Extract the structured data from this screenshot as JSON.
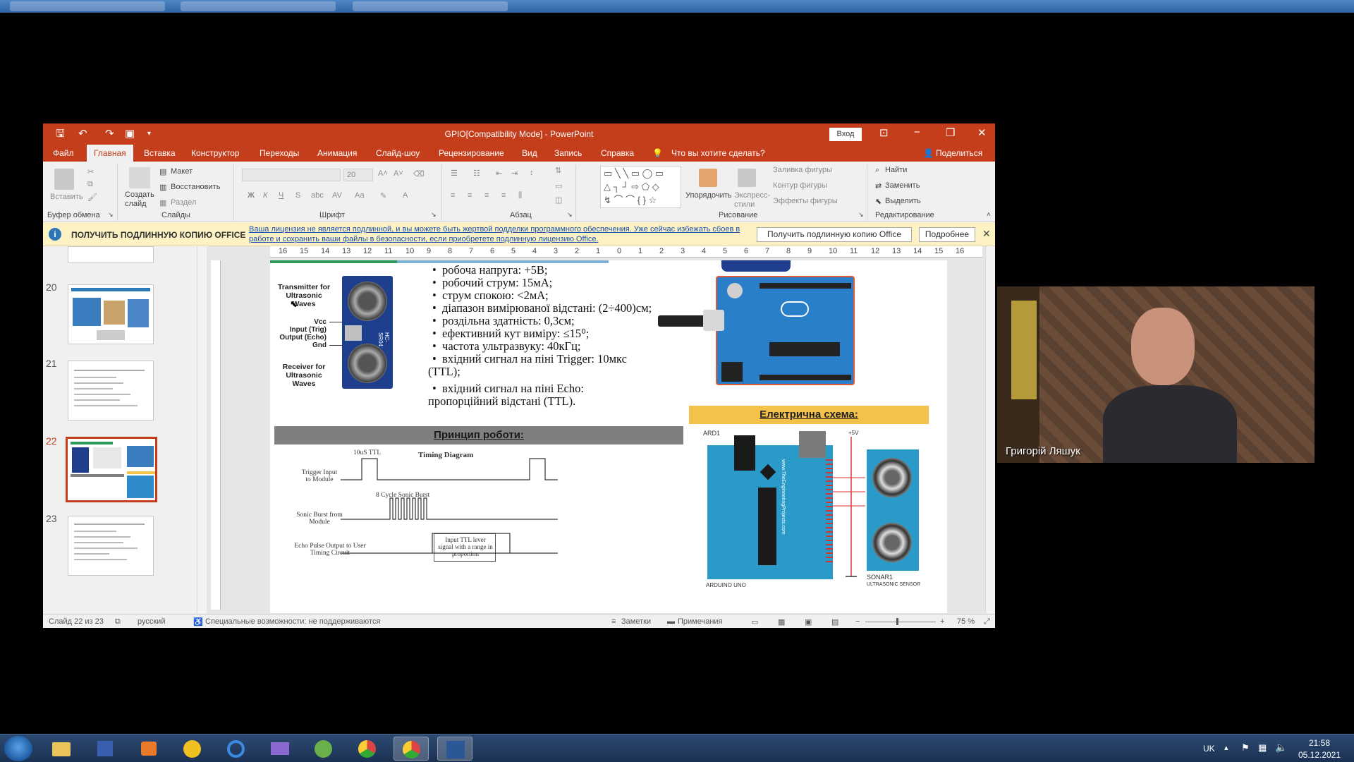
{
  "window": {
    "title": "GPIO[Compatibility Mode] - PowerPoint",
    "signin": "Вход"
  },
  "ribbon_tabs": [
    "Файл",
    "Главная",
    "Вставка",
    "Конструктор",
    "Переходы",
    "Анимация",
    "Слайд-шоу",
    "Рецензирование",
    "Вид",
    "Запись",
    "Справка"
  ],
  "tell_me": "Что вы хотите сделать?",
  "share": "Поделиться",
  "ribbon": {
    "clipboard": {
      "paste": "Вставить",
      "group": "Буфер обмена"
    },
    "slides": {
      "new_slide": "Создать слайд",
      "layout": "Макет",
      "reset": "Восстановить",
      "section": "Раздел",
      "group": "Слайды"
    },
    "font": {
      "size": "20",
      "group": "Шрифт",
      "bold": "Ж",
      "italic": "К",
      "underline": "Ч",
      "strike": "S",
      "aa": "Аа"
    },
    "paragraph": {
      "group": "Абзац"
    },
    "drawing": {
      "arrange": "Упорядочить",
      "quick_styles": "Экспресс-стили",
      "fill": "Заливка фигуры",
      "outline": "Контур фигуры",
      "effects": "Эффекты фигуры",
      "group": "Рисование"
    },
    "editing": {
      "find": "Найти",
      "replace": "Заменить",
      "select": "Выделить",
      "group": "Редактирование"
    }
  },
  "infobar": {
    "heading": "ПОЛУЧИТЬ ПОДЛИННУЮ КОПИЮ OFFICE",
    "message": "Ваша лицензия не является подлинной, и вы можете быть жертвой подделки программного обеспечения. Уже сейчас избежать сбоев в работе и сохранить ваши файлы в безопасности, если приобретете подлинную лицензию Office.",
    "get_button": "Получить подлинную копию Office",
    "more_button": "Подробнее"
  },
  "thumbnails": [
    "20",
    "21",
    "22",
    "23"
  ],
  "ruler_labels": [
    "16",
    "15",
    "14",
    "13",
    "12",
    "11",
    "10",
    "9",
    "8",
    "7",
    "6",
    "5",
    "4",
    "3",
    "2",
    "1",
    "0",
    "1",
    "2",
    "3",
    "4",
    "5",
    "6",
    "7",
    "8",
    "9",
    "10",
    "11",
    "12",
    "13",
    "14",
    "15",
    "16"
  ],
  "slide": {
    "bullets": [
      "робоча напруга: +5В;",
      "робочий струм: 15мА;",
      "струм спокою: <2мА;",
      "діапазон вимірюваної відстані: (2÷400)см;",
      "роздільна здатність: 0,3см;",
      "ефективний кут виміру: ≤15⁰;",
      "частота ультразвуку: 40кГц;",
      "вхідний сигнал на піні Trigger: 10мкс",
      "(TTL);",
      "вхідний сигнал на піні Echo:",
      "пропорційний відстані (TTL)."
    ],
    "sensor": {
      "transmitter": "Transmitter for Ultrasonic Waves",
      "receiver": "Receiver for Ultrasonic Waves",
      "vcc": "Vcc",
      "trig": "Input (Trig)",
      "echo": "Output (Echo)",
      "gnd": "Gnd",
      "model": "HC-SR04"
    },
    "principle_title": "Принцип роботи:",
    "schema_title": "Електрична схема:",
    "timing": {
      "title": "Timing Diagram",
      "ttl": "10uS TTL",
      "trigger": "Trigger Input to Module",
      "burst": "8 Cycle Sonic Burst",
      "sonic": "Sonic Burst from Module",
      "echo": "Echo Pulse Output to User Timing Circuit",
      "input_ttl": "Input TTL lever signal with a range in proportion"
    },
    "schematic": {
      "ard": "ARD1",
      "arduino": "ARDUINO UNO",
      "sonar": "SONAR1",
      "sonar_sub": "ULTRASONIC SENSOR",
      "vplus": "+5V",
      "website": "www.TheEngineeringProjects.com"
    }
  },
  "statusbar": {
    "slide": "Слайд 22 из 23",
    "lang": "русский",
    "accessibility": "Специальные возможности: не поддерживаются",
    "notes": "Заметки",
    "comments": "Примечания",
    "zoom": "75 %"
  },
  "webcam": {
    "name": "Григорій Ляшук"
  },
  "taskbar": {
    "lang": "UK",
    "time": "21:58",
    "date": "05.12.2021"
  }
}
